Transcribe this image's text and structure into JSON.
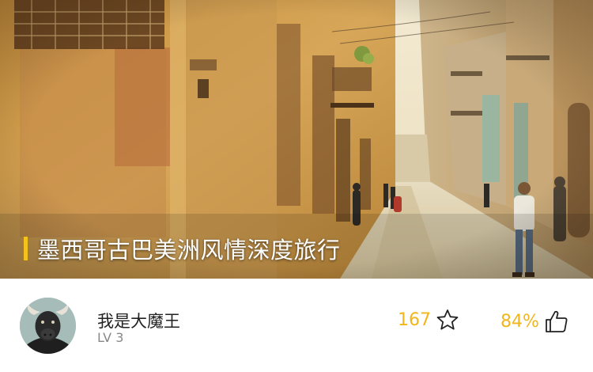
{
  "post": {
    "title": "墨西哥古巴美洲风情深度旅行",
    "accent_color": "#f5c21b"
  },
  "author": {
    "name": "我是大魔王",
    "level": "LV 3",
    "avatar_icon": "bull-avatar"
  },
  "stats": {
    "favorites": "167",
    "favorite_icon": "star-outline-icon",
    "like_rate": "84%",
    "like_icon": "thumbs-up-outline-icon",
    "color": "#f2b51c"
  }
}
